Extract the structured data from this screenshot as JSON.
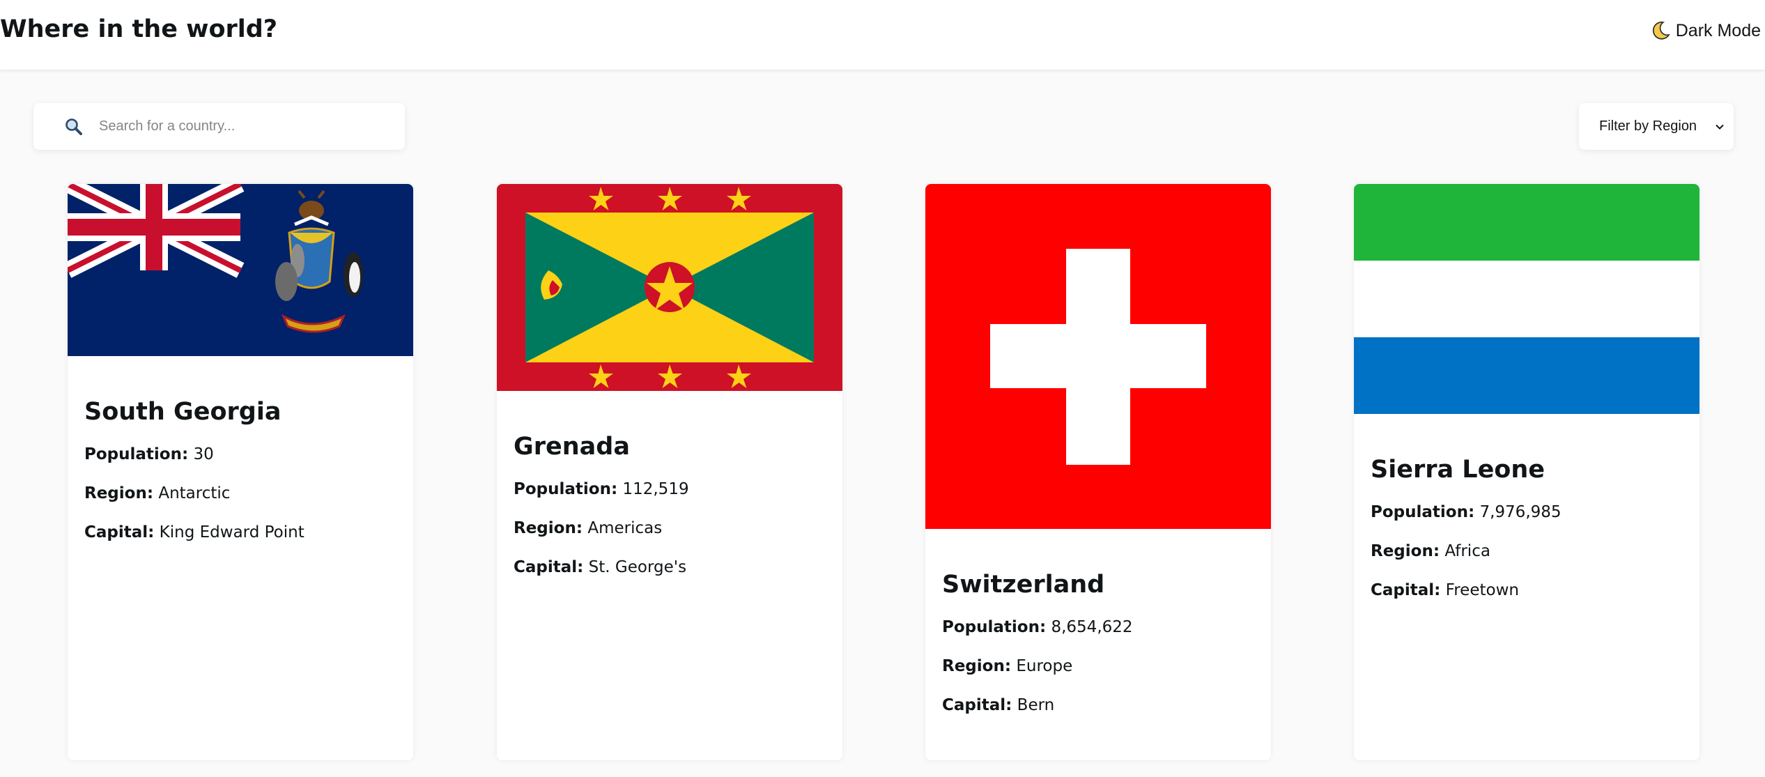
{
  "header": {
    "title": "Where in the world?",
    "dark_mode_label": "Dark Mode"
  },
  "search": {
    "placeholder": "Search for a country..."
  },
  "filter": {
    "label": "Filter by Region"
  },
  "stat_labels": {
    "population": "Population:",
    "region": "Region:",
    "capital": "Capital:"
  },
  "countries": [
    {
      "name": "South Georgia",
      "population": "30",
      "region": "Antarctic",
      "capital": "King Edward Point"
    },
    {
      "name": "Grenada",
      "population": "112,519",
      "region": "Americas",
      "capital": "St. George's"
    },
    {
      "name": "Switzerland",
      "population": "8,654,622",
      "region": "Europe",
      "capital": "Bern"
    },
    {
      "name": "Sierra Leone",
      "population": "7,976,985",
      "region": "Africa",
      "capital": "Freetown"
    }
  ],
  "colors": {
    "background": "#fafafa",
    "card": "#ffffff",
    "text": "#111517",
    "placeholder": "#858585"
  }
}
